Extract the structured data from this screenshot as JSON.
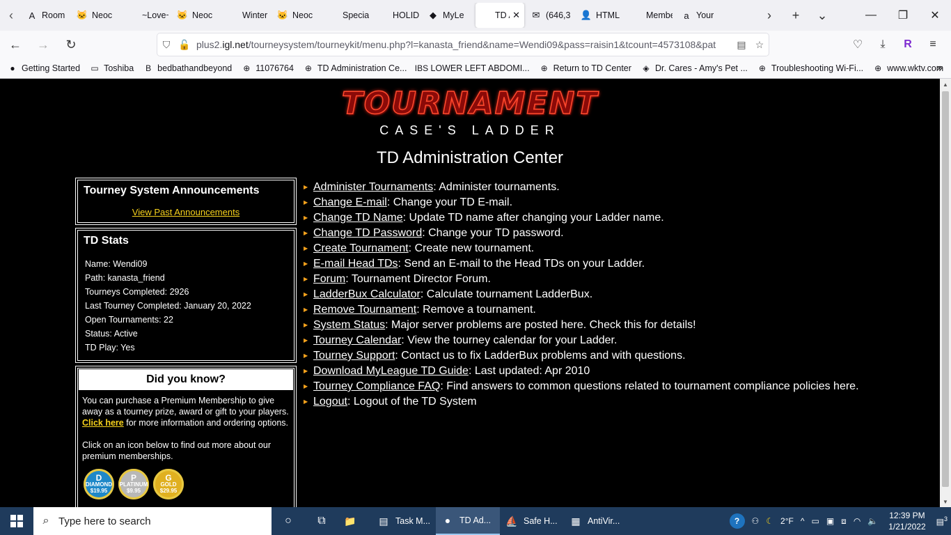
{
  "browser": {
    "tabs": [
      {
        "title": "Room",
        "icon": "A"
      },
      {
        "title": "Neoc",
        "icon": "🐱"
      },
      {
        "title": "~Love~",
        "icon": ""
      },
      {
        "title": "Neoc",
        "icon": "🐱"
      },
      {
        "title": "Winter Ro",
        "icon": ""
      },
      {
        "title": "Neoc",
        "icon": "🐱"
      },
      {
        "title": "Specials C",
        "icon": ""
      },
      {
        "title": "HOLIDAY",
        "icon": ""
      },
      {
        "title": "MyLe",
        "icon": "◆"
      },
      {
        "title": "TD Adm",
        "icon": ""
      },
      {
        "title": "(646,3",
        "icon": "✉"
      },
      {
        "title": "HTML",
        "icon": "👤"
      },
      {
        "title": "Membersh",
        "icon": ""
      },
      {
        "title": "Your",
        "icon": "a"
      }
    ],
    "url_prefix": "plus2.",
    "url_domain": "igl.net",
    "url_rest": "/tourneysystem/tourneykit/menu.php?l=kanasta_friend&name=Wendi09&pass=raisin1&tcount=4573108&pat",
    "bookmarks": [
      {
        "label": "Getting Started",
        "icon": "●"
      },
      {
        "label": "Toshiba",
        "icon": "▭"
      },
      {
        "label": "bedbathandbeyond",
        "icon": "B"
      },
      {
        "label": "11076764",
        "icon": "⊕"
      },
      {
        "label": "TD Administration Ce...",
        "icon": "⊕"
      },
      {
        "label": "LOWER LEFT ABDOMI...",
        "icon": "IBS"
      },
      {
        "label": "Return to TD Center",
        "icon": "⊕"
      },
      {
        "label": "Dr. Cares - Amy's Pet ...",
        "icon": "◈"
      },
      {
        "label": "Troubleshooting Wi-Fi...",
        "icon": "⊕"
      },
      {
        "label": "www.wktv.com",
        "icon": "⊕"
      }
    ]
  },
  "page": {
    "logo_big": "TOURNAMENT",
    "logo_small": "CASE'S LADDER",
    "title": "TD Administration Center",
    "announcements": {
      "heading": "Tourney System Announcements",
      "link": "View Past Announcements"
    },
    "stats": {
      "heading": "TD Stats",
      "lines": [
        "Name: Wendi09",
        "Path: kanasta_friend",
        "Tourneys Completed: 2926",
        "Last Tourney Completed: January 20, 2022",
        "Open Tournaments: 22",
        "Status: Active",
        "TD Play: Yes"
      ]
    },
    "dyk": {
      "heading": "Did you know?",
      "text1": "You can purchase a Premium Membership to give away as a tourney prize, award or gift to your players.",
      "link": "Click here",
      "text2": "for more information and ordering options.",
      "text3": "Click on an icon below to find out more about our premium memberships.",
      "medals": [
        {
          "name": "DIAMOND",
          "letter": "D",
          "price": "$19.95",
          "color": "#1e88c8"
        },
        {
          "name": "PLATINUM",
          "letter": "P",
          "price": "$9.95",
          "color": "#b8b8b8"
        },
        {
          "name": "GOLD",
          "letter": "G",
          "price": "$29.95",
          "color": "#e0b020"
        }
      ]
    },
    "menu": [
      {
        "link": "Administer Tournaments ",
        "desc": ": Administer tournaments."
      },
      {
        "link": "Change E-mail ",
        "desc": ": Change your TD E-mail."
      },
      {
        "link": "Change TD Name ",
        "desc": ": Update TD name after changing your Ladder name."
      },
      {
        "link": "Change TD Password ",
        "desc": ": Change your TD password."
      },
      {
        "link": "Create Tournament ",
        "desc": ": Create new tournament."
      },
      {
        "link": "E-mail Head TDs ",
        "desc": ": Send an E-mail to the Head TDs on your Ladder."
      },
      {
        "link": "Forum ",
        "desc": ": Tournament Director Forum."
      },
      {
        "link": "LadderBux Calculator ",
        "desc": ": Calculate tournament LadderBux."
      },
      {
        "link": "Remove Tournament ",
        "desc": ": Remove a tournament."
      },
      {
        "link": "System Status ",
        "desc": ": Major server problems are posted here. Check this for details!"
      },
      {
        "link": "Tourney Calendar ",
        "desc": ": View the tourney calendar for your Ladder."
      },
      {
        "link": "Tourney Support ",
        "desc": ": Contact us to fix LadderBux problems and with questions."
      },
      {
        "link": "Download MyLeague TD Guide ",
        "desc": ": Last updated: Apr 2010"
      },
      {
        "link": "Tourney Compliance FAQ ",
        "desc": ": Find answers to common questions related to tournament compliance policies here."
      },
      {
        "link": "Logout ",
        "desc": ": Logout of the TD System"
      }
    ]
  },
  "taskbar": {
    "search_placeholder": "Type here to search",
    "apps": [
      {
        "label": "",
        "icon": "📁"
      },
      {
        "label": "Task M...",
        "icon": "▤"
      },
      {
        "label": "TD Ad...",
        "icon": "●"
      },
      {
        "label": "Safe H...",
        "icon": "⛵"
      },
      {
        "label": "AntiVir...",
        "icon": "▦"
      }
    ],
    "weather": "2°F",
    "time": "12:39 PM",
    "date": "1/21/2022",
    "notif_count": "3"
  }
}
